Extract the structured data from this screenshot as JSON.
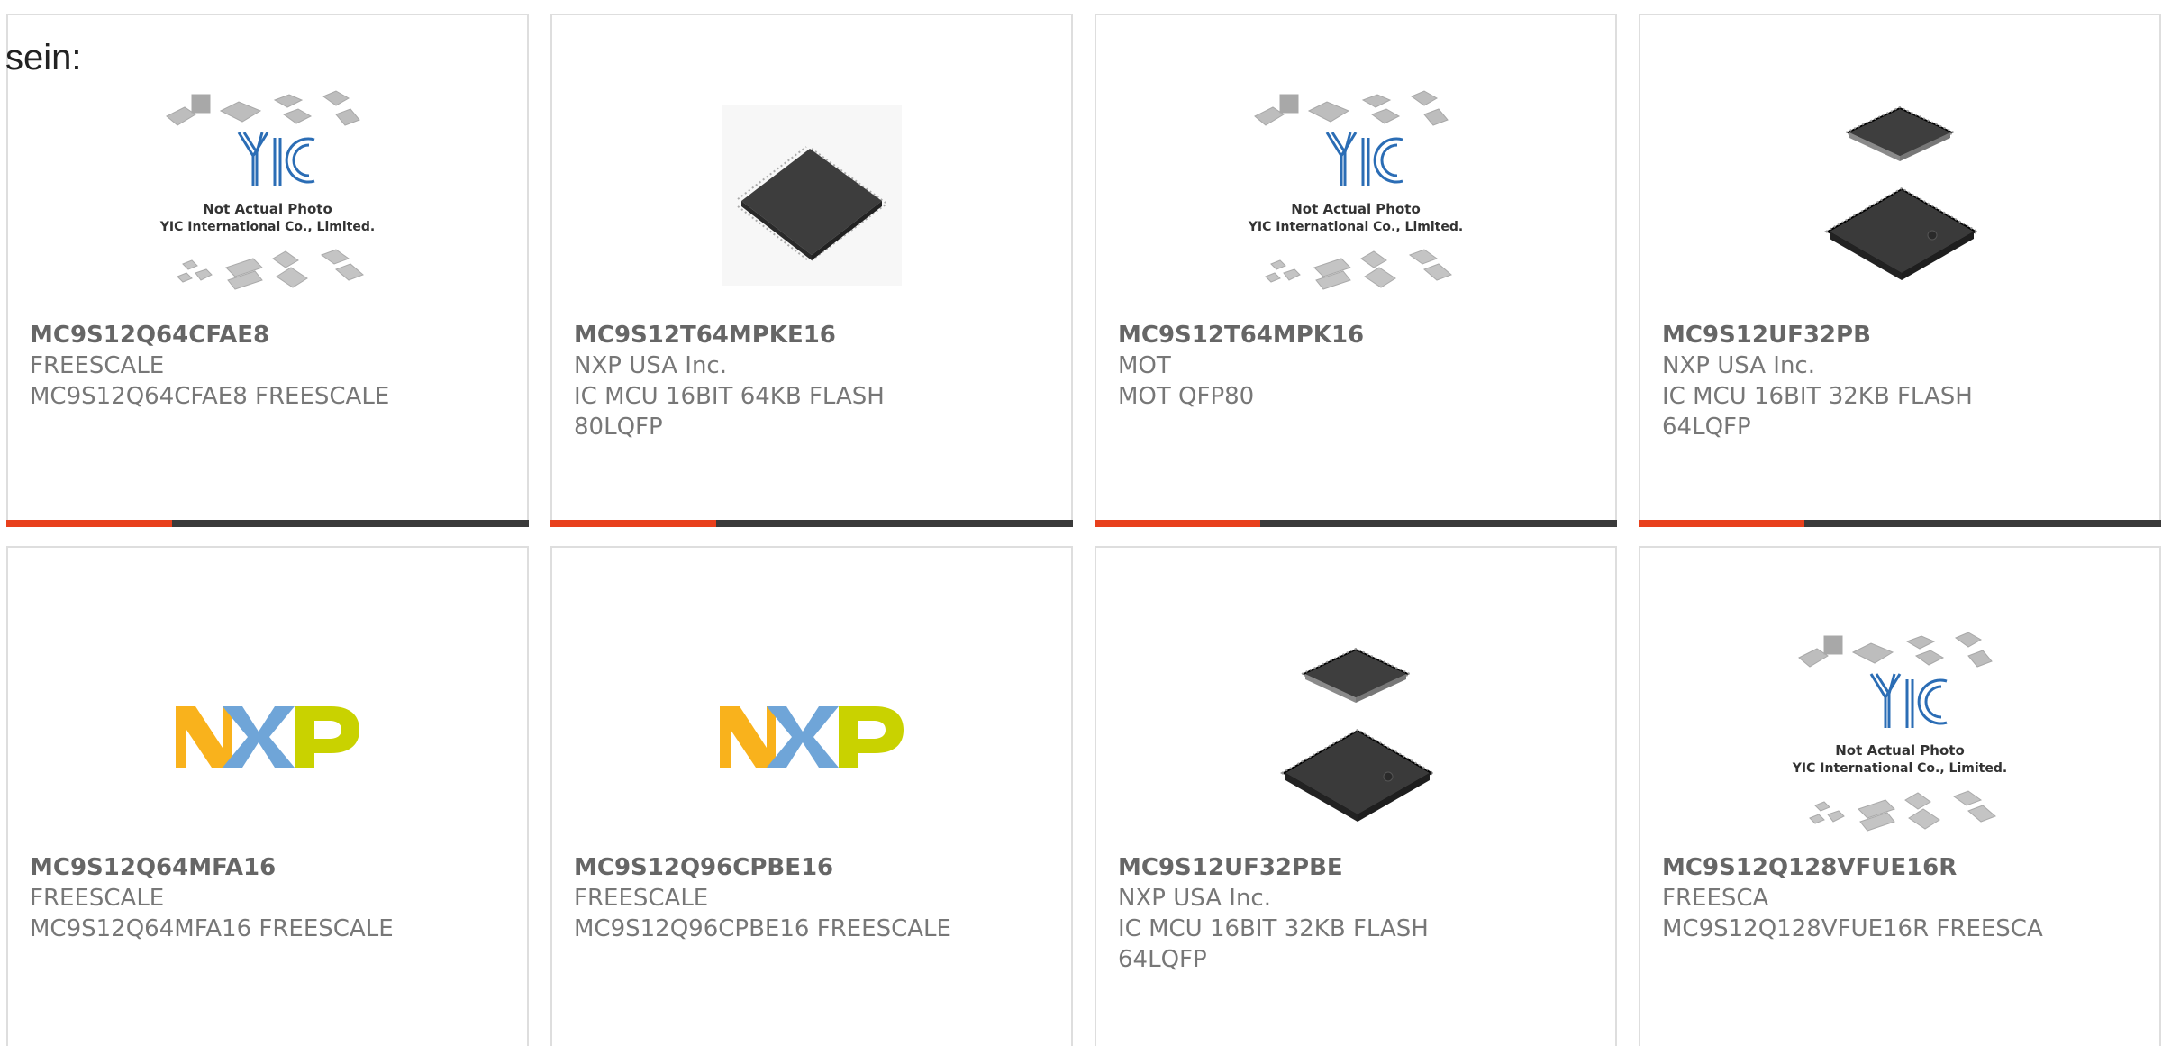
{
  "lead_text": "sein:",
  "colors": {
    "accent": "#e8401c",
    "bar": "#3a3a3a",
    "nxp_orange": "#f9b21c",
    "nxp_blue": "#6fa5d8",
    "nxp_green": "#c9d200",
    "yic_blue": "#2b6db5"
  },
  "placeholder_caption": {
    "line1": "Not Actual Photo",
    "line2": "YIC International Co., Limited."
  },
  "products": [
    {
      "pn": "MC9S12Q64CFAE8",
      "mfr": "FREESCALE",
      "desc": "MC9S12Q64CFAE8 FREESCALE",
      "image": "yic-placeholder"
    },
    {
      "pn": "MC9S12T64MPKE16",
      "mfr": "NXP USA Inc.",
      "desc": "IC MCU 16BIT 64KB FLASH 80LQFP",
      "image": "qfp-chip"
    },
    {
      "pn": "MC9S12T64MPK16",
      "mfr": "MOT",
      "desc": "MOT QFP80",
      "image": "yic-placeholder"
    },
    {
      "pn": "MC9S12UF32PB",
      "mfr": "NXP USA Inc.",
      "desc": "IC MCU 16BIT 32KB FLASH 64LQFP",
      "image": "qfp-chip-pair"
    },
    {
      "pn": "MC9S12Q64MFA16",
      "mfr": "FREESCALE",
      "desc": "MC9S12Q64MFA16 FREESCALE",
      "image": "nxp-logo"
    },
    {
      "pn": "MC9S12Q96CPBE16",
      "mfr": "FREESCALE",
      "desc": "MC9S12Q96CPBE16 FREESCALE",
      "image": "nxp-logo"
    },
    {
      "pn": "MC9S12UF32PBE",
      "mfr": "NXP USA Inc.",
      "desc": "IC MCU 16BIT 32KB FLASH 64LQFP",
      "image": "qfp-chip-pair"
    },
    {
      "pn": "MC9S12Q128VFUE16R",
      "mfr": "FREESCA",
      "desc": "MC9S12Q128VFUE16R FREESCA",
      "image": "yic-placeholder"
    }
  ]
}
